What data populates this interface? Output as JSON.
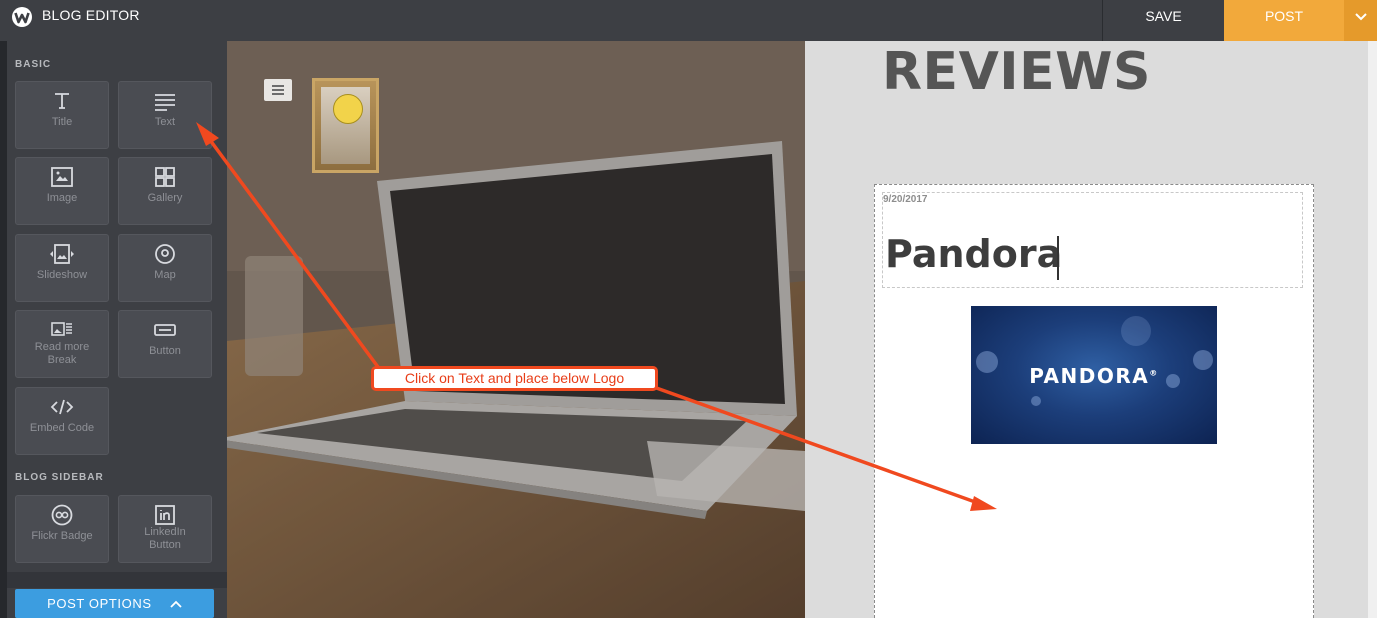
{
  "app": {
    "title": "BLOG EDITOR"
  },
  "toolbar": {
    "save_label": "SAVE",
    "post_label": "POST",
    "caret": "❯"
  },
  "sidebar": {
    "basic_label": "BASIC",
    "blog_sidebar_label": "BLOG SIDEBAR",
    "basic_items": [
      {
        "label": "Title",
        "icon": "title-icon"
      },
      {
        "label": "Text",
        "icon": "text-icon"
      },
      {
        "label": "Image",
        "icon": "image-icon"
      },
      {
        "label": "Gallery",
        "icon": "gallery-icon"
      },
      {
        "label": "Slideshow",
        "icon": "slideshow-icon"
      },
      {
        "label": "Map",
        "icon": "map-pin-icon"
      },
      {
        "label": "Read more Break",
        "icon": "read-more-icon"
      },
      {
        "label": "Button",
        "icon": "button-icon"
      },
      {
        "label": "Embed Code",
        "icon": "embed-code-icon"
      }
    ],
    "blog_sidebar_items": [
      {
        "label": "Flickr Badge",
        "icon": "flickr-icon"
      },
      {
        "label": "LinkedIn Button",
        "icon": "linkedin-icon"
      }
    ],
    "post_options_label": "POST OPTIONS",
    "post_options_caret": "^"
  },
  "page": {
    "heading": "REVIEWS",
    "post": {
      "date": "9/20/2017",
      "title": "Pandora",
      "image_text": "PANDORA",
      "image_mark": "®"
    }
  },
  "annotation": {
    "text": "Click on Text and place below Logo",
    "color": "#f0491f"
  },
  "colors": {
    "topbar": "#3d3f44",
    "post_button": "#f2a93b",
    "post_options": "#3c9de0"
  }
}
